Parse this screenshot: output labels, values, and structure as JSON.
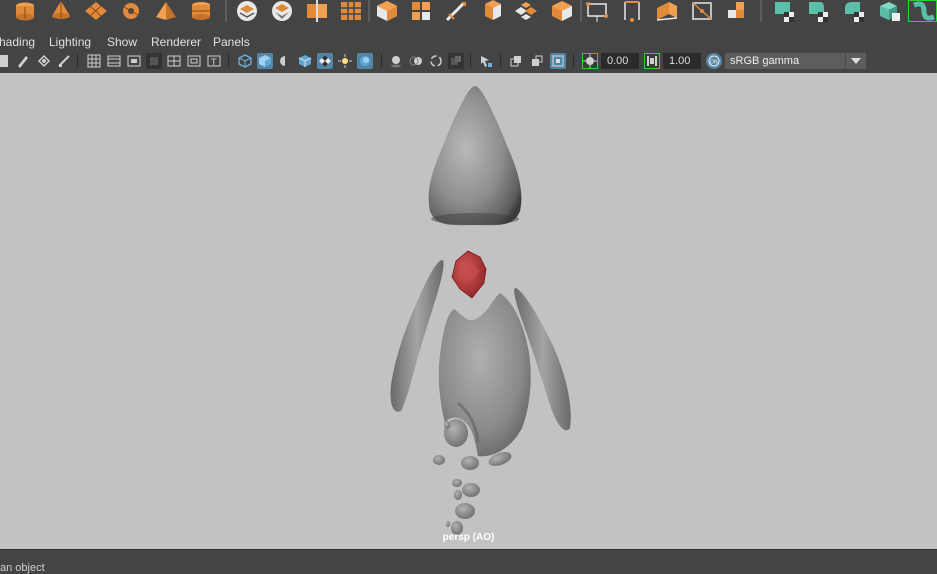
{
  "shelf": {
    "icons": [
      "poly-cylinder-icon",
      "poly-cone-icon",
      "poly-plane-icon",
      "poly-torus-icon",
      "poly-pyramid-icon",
      "poly-pipe-icon",
      "combine-icon",
      "separate-icon",
      "mirror-icon",
      "smooth-icon",
      "bevel-icon",
      "bridge-icon",
      "multicut-icon",
      "extrude-icon",
      "append-polygon-icon",
      "fill-hole-icon",
      "uv-layout-icon",
      "target-weld-icon",
      "insert-edge-loop-icon",
      "quad-draw-icon",
      "unfold-icon",
      "sweep-mesh-icon",
      "cut-uvs-icon",
      "sew-uvs-icon",
      "planar-mapping-icon"
    ],
    "accent_color": "#e08a3c",
    "teal_color": "#5bbfa8"
  },
  "menu": {
    "items": [
      "hading",
      "Lighting",
      "Show",
      "Renderer",
      "Panels"
    ]
  },
  "toolbar": {
    "exposure_value": "0.00",
    "gamma_value": "1.00",
    "color_space": "sRGB gamma",
    "icons": [
      "select-camera-icon",
      "camera-attributes-icon",
      "bookmarks-icon",
      "image-plane-icon",
      "grid-icon",
      "film-gate-icon",
      "resolution-gate-icon",
      "gate-mask-icon",
      "field-chart-icon",
      "safe-action-icon",
      "safe-title-icon",
      "wireframe-icon",
      "smooth-shade-icon",
      "use-default-material-icon",
      "wireframe-on-shaded-icon",
      "textured-icon",
      "use-all-lights-icon",
      "shadows-icon",
      "screen-space-ao-icon",
      "motion-blur-icon",
      "multisample-aa-icon",
      "depth-of-field-icon",
      "isolate-select-icon",
      "xray-icon",
      "xray-joints-icon",
      "xray-components-icon",
      "backface-culling-icon",
      "two-sided-lighting-icon",
      "view-transform-icon"
    ]
  },
  "viewport": {
    "camera_label": "persp (AO)",
    "background_color": "#c2c2c2",
    "mesh_color": "#8a8a8a",
    "selected_mesh_color": "#b53a3a"
  },
  "helpline": {
    "text": "an object"
  }
}
